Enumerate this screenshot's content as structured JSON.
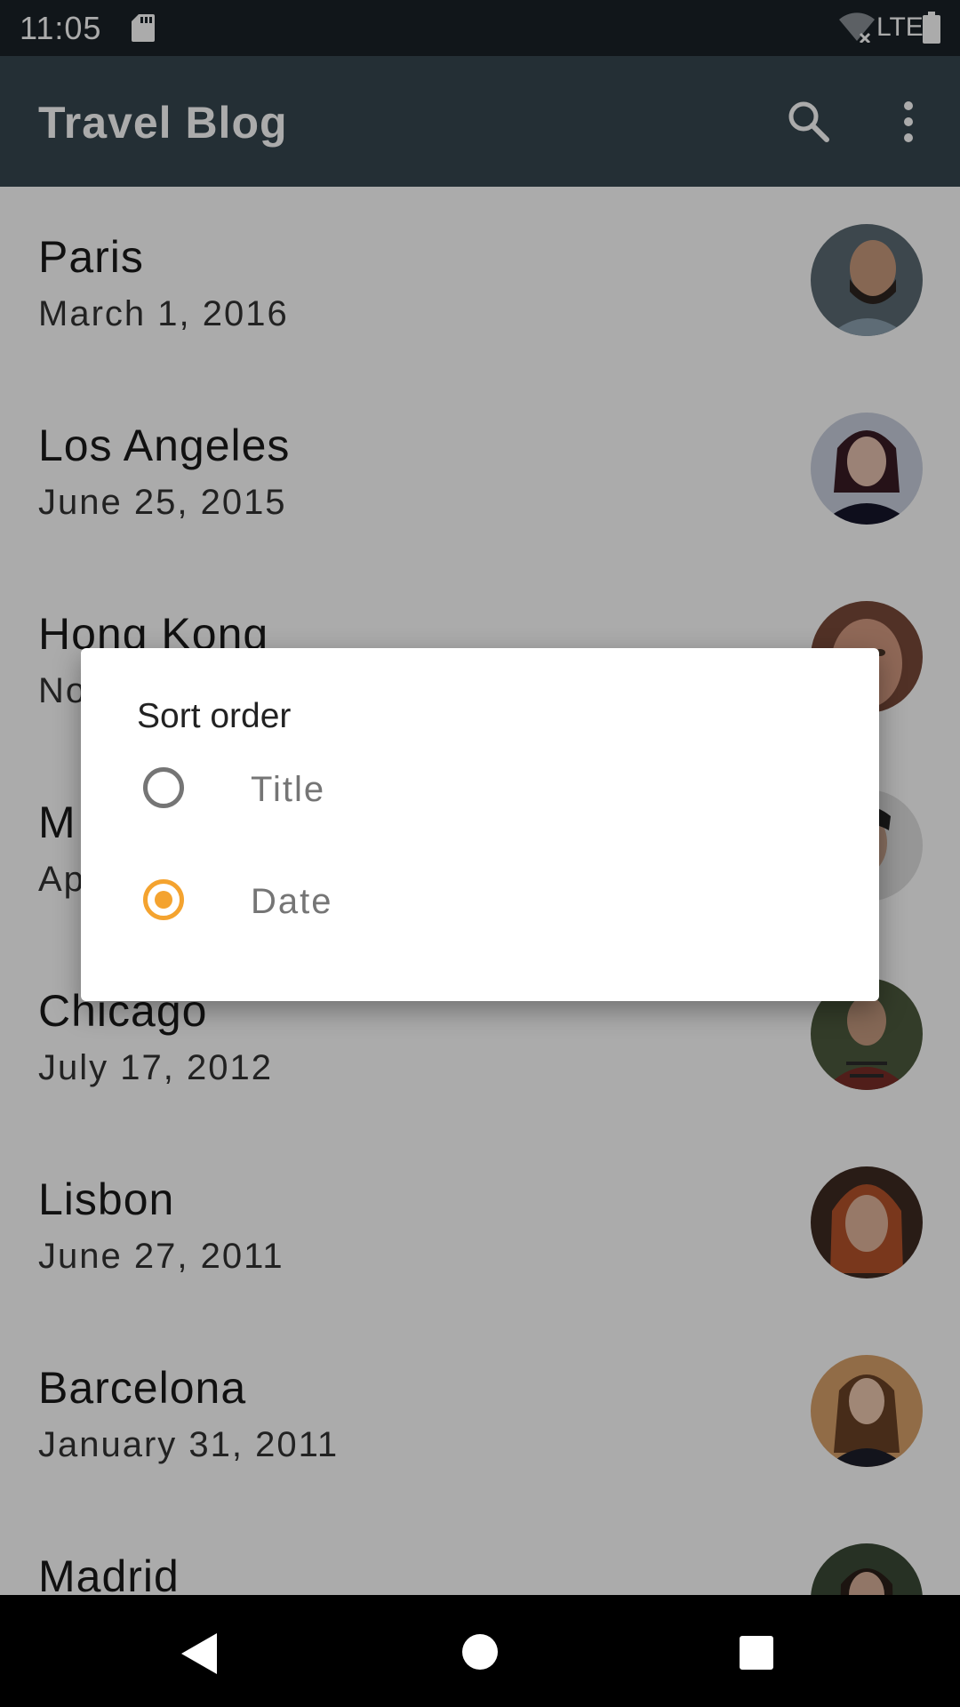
{
  "status_bar": {
    "time": "11:05",
    "network": "LTE"
  },
  "app_bar": {
    "title": "Travel Blog",
    "search_icon": "search-icon",
    "more_icon": "more-vert-icon"
  },
  "list": {
    "items": [
      {
        "title": "Paris",
        "date": "March 1, 2016"
      },
      {
        "title": "Los Angeles",
        "date": "June 25, 2015"
      },
      {
        "title": "Hong Kong",
        "date": "No"
      },
      {
        "title": "M",
        "date": "Ap"
      },
      {
        "title": "Chicago",
        "date": "July 17, 2012"
      },
      {
        "title": "Lisbon",
        "date": "June 27, 2011"
      },
      {
        "title": "Barcelona",
        "date": "January 31, 2011"
      },
      {
        "title": "Madrid",
        "date": ""
      }
    ]
  },
  "dialog": {
    "title": "Sort order",
    "options": [
      {
        "label": "Title",
        "selected": false
      },
      {
        "label": "Date",
        "selected": true
      }
    ],
    "accent_color": "#f4a32f"
  },
  "nav_bar": {
    "back_icon": "back-icon",
    "home_icon": "home-icon",
    "recents_icon": "recents-icon"
  }
}
